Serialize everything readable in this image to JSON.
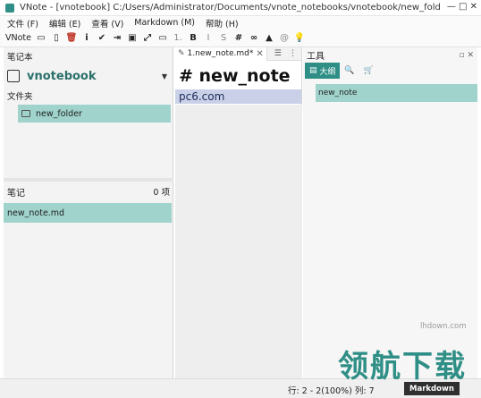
{
  "window": {
    "title": "VNote - [vnotebook] C:/Users/Administrator/Documents/vnote_notebooks/vnotebook/new_folder/n...",
    "controls": "—  □  ✕"
  },
  "menubar": [
    "文件 (F)",
    "编辑 (E)",
    "查看 (V)",
    "Markdown (M)",
    "帮助 (H)"
  ],
  "toolbar": {
    "label": "VNote",
    "icons": [
      "folder-icon",
      "file-icon",
      "delete-icon",
      "info-icon",
      "check-icon",
      "export-icon",
      "save-icon",
      "expand-icon",
      "monitor-icon",
      "heading-icon",
      "bold-icon",
      "italic-icon",
      "strikethrough-icon",
      "code-icon",
      "link-icon",
      "image-icon",
      "attachment-icon",
      "bulb-icon"
    ],
    "glyphs": [
      "▭",
      "▯",
      "🗑",
      "i",
      "✔",
      "⇥",
      "▣",
      "⤢",
      "▭",
      "1.",
      "B",
      "I",
      "S",
      "#",
      "∞",
      "▲",
      "@",
      "💡"
    ]
  },
  "left_panel": {
    "title": "笔记本",
    "notebook": "vnotebook",
    "folders_title": "文件夹",
    "folder": "new_folder",
    "notes_title": "笔记",
    "notes_count": "0 项",
    "note": "new_note.md"
  },
  "editor": {
    "tab_name": "1.new_note.md*",
    "heading": "# new_note",
    "line": "pc6.com"
  },
  "tools": {
    "title": "工具",
    "outline_tab": "大纲",
    "outline_item": "new_note"
  },
  "statusbar": {
    "position": "行: 2 - 2(100%) 列: 7",
    "mode": "Markdown"
  },
  "watermark": {
    "url": "lhdown.com",
    "text": "领航下载"
  }
}
